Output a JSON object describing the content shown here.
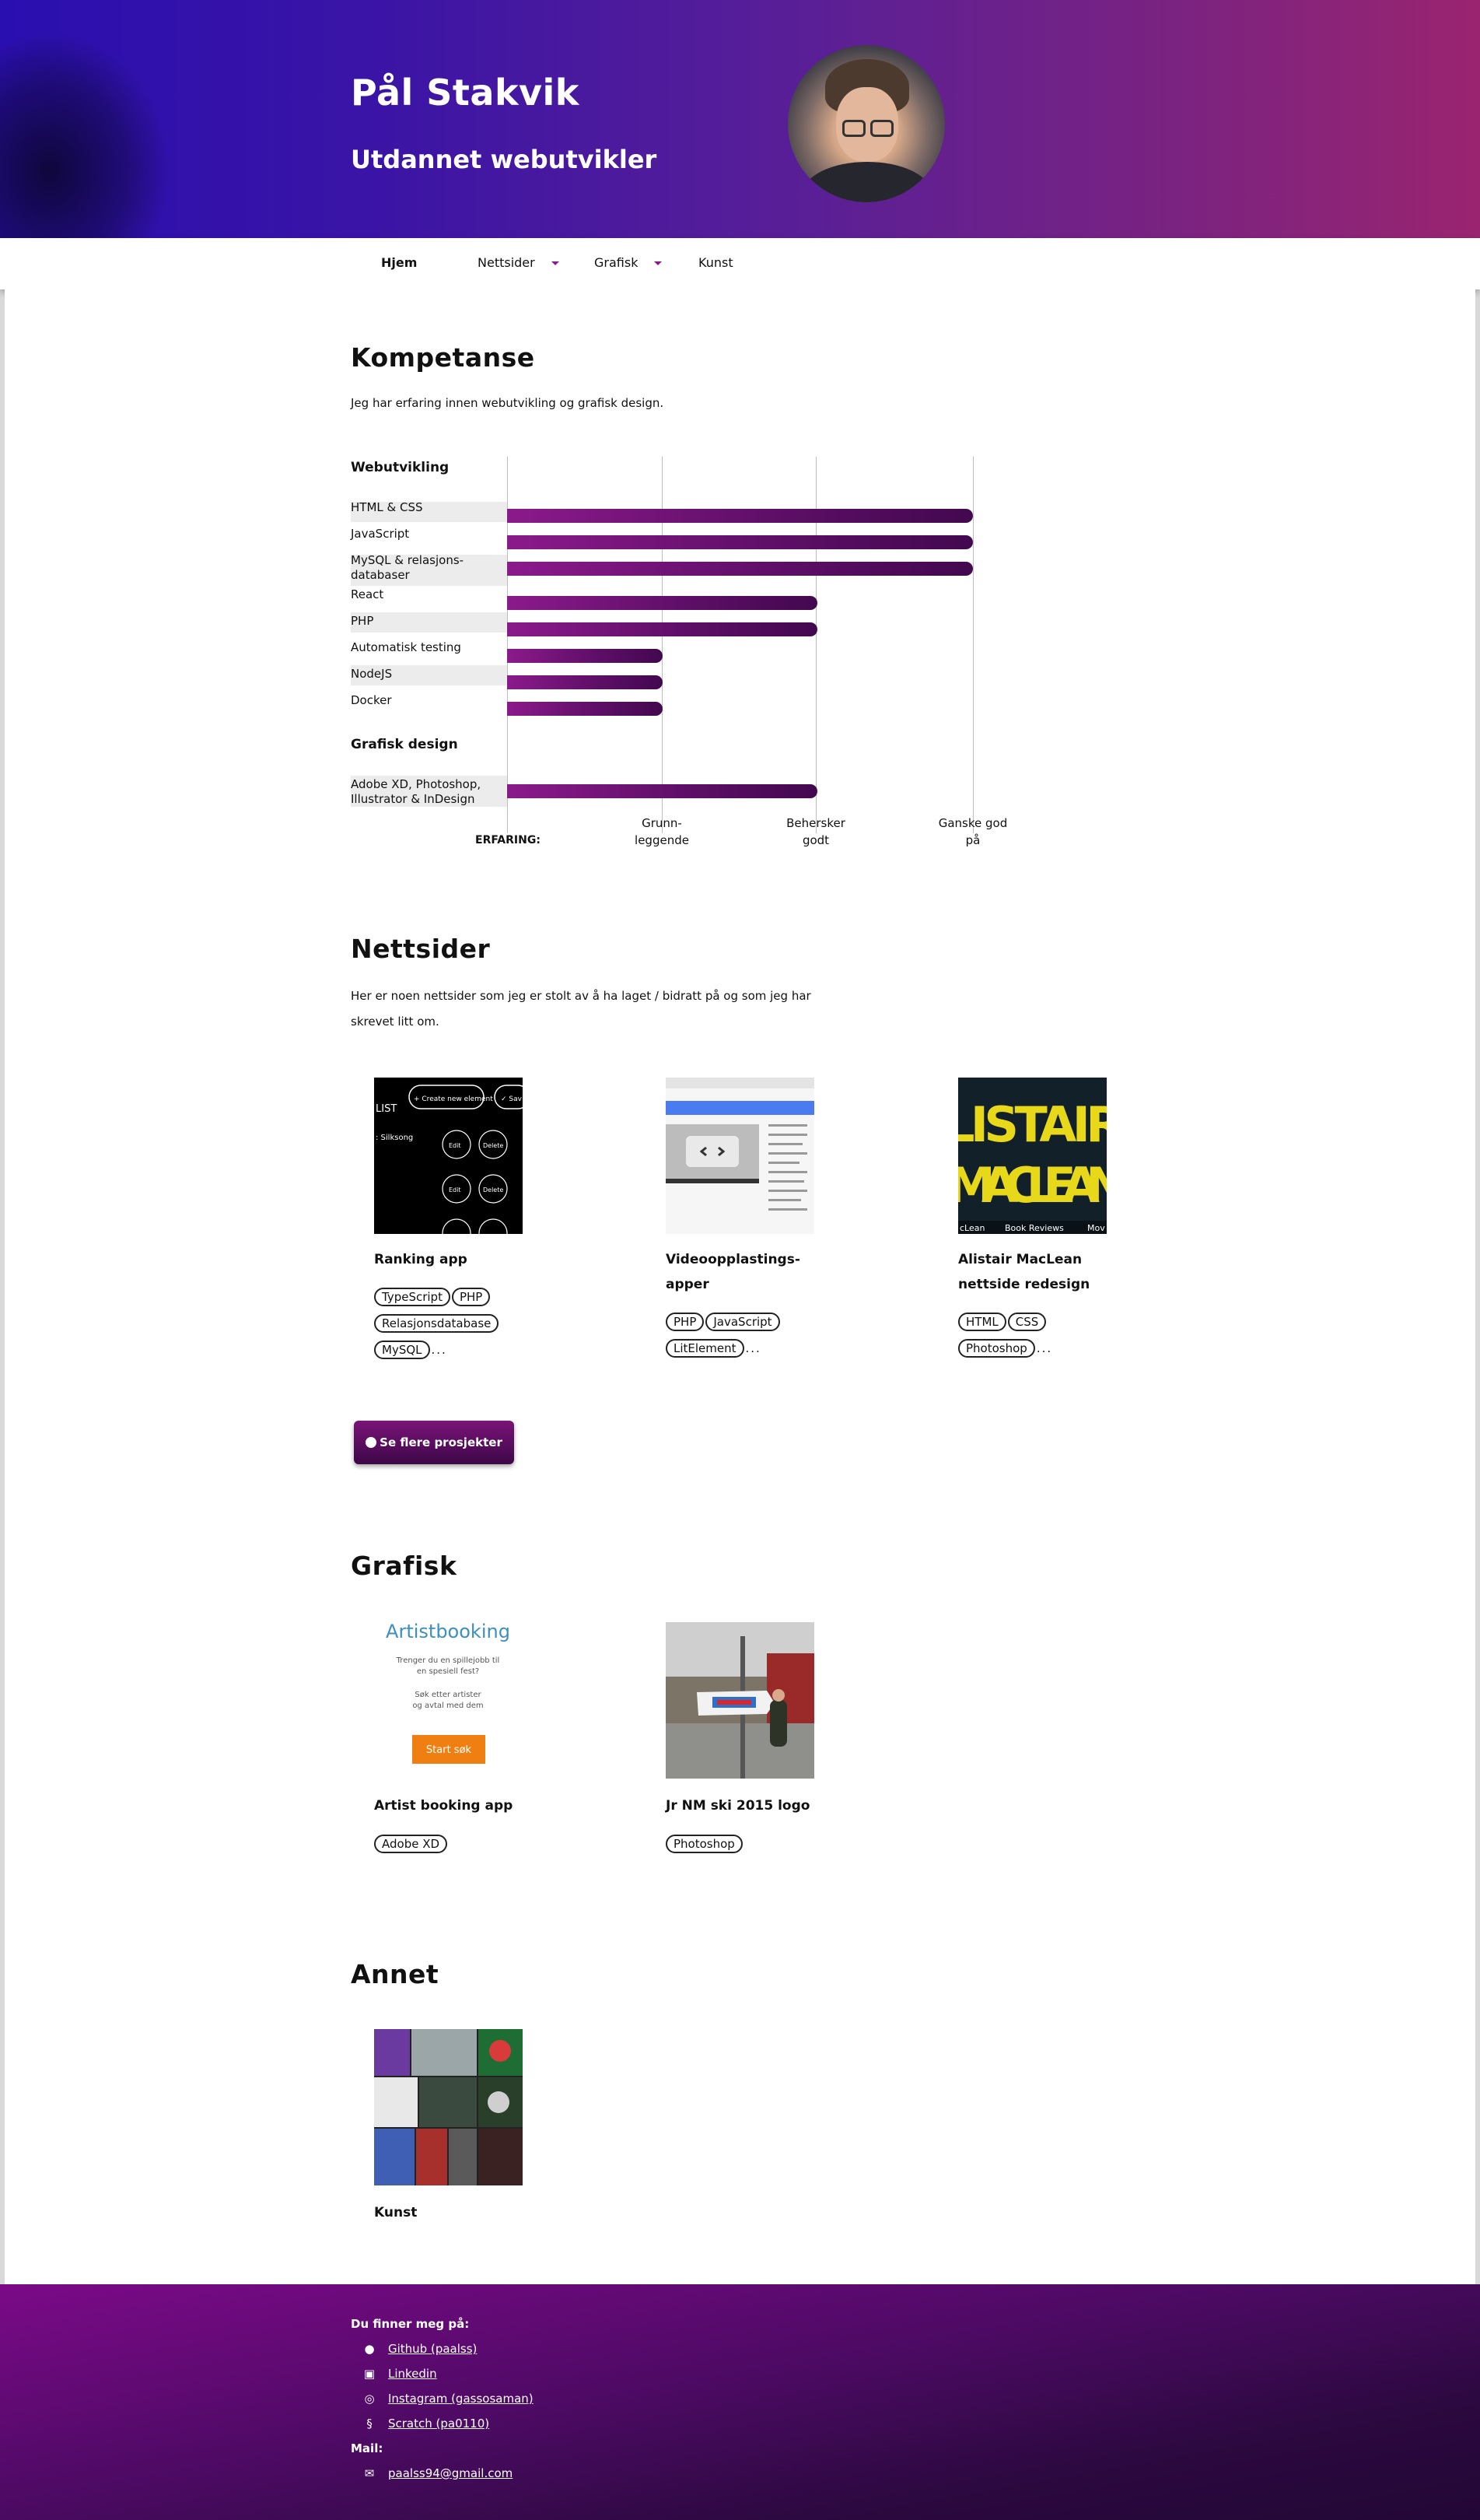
{
  "header": {
    "name": "Pål Stakvik",
    "role": "Utdannet webutvikler",
    "gradient_colors": [
      "#2a0fb0",
      "#9a2470"
    ]
  },
  "nav": {
    "items": [
      {
        "label": "Hjem",
        "active": true,
        "dropdown": false
      },
      {
        "label": "Nettsider",
        "active": false,
        "dropdown": true
      },
      {
        "label": "Grafisk",
        "active": false,
        "dropdown": true
      },
      {
        "label": "Kunst",
        "active": false,
        "dropdown": false
      }
    ]
  },
  "kompetanse": {
    "title": "Kompetanse",
    "intro": "Jeg har erfaring innen webutvikling og grafisk design.",
    "axis_title": "ERFARING:",
    "axis_levels": [
      "Grunn-leggende",
      "Behersker godt",
      "Ganske god på"
    ],
    "axis_lines": [
      [
        "Grunn-",
        "leggende"
      ],
      [
        "Behersker",
        "godt"
      ],
      [
        "Ganske god",
        "på"
      ]
    ]
  },
  "chart_data": {
    "type": "bar",
    "orientation": "horizontal",
    "title": "",
    "xlabel": "ERFARING:",
    "x_categories": [
      "Grunn-leggende",
      "Behersker godt",
      "Ganske god på"
    ],
    "xlim": [
      0,
      3
    ],
    "groups": [
      {
        "name": "Webutvikling",
        "categories": [
          "HTML & CSS",
          "JavaScript",
          "MySQL & relasjons-databaser",
          "React",
          "PHP",
          "Automatisk testing",
          "NodeJS",
          "Docker"
        ],
        "values": [
          3,
          3,
          3,
          2,
          2,
          1,
          1,
          1
        ]
      },
      {
        "name": "Grafisk design",
        "categories": [
          "Adobe XD, Photoshop, Illustrator & InDesign"
        ],
        "values": [
          2
        ]
      }
    ],
    "bar_color": "#6a0f73",
    "grid": true
  },
  "skill_labels": {
    "html": "HTML & CSS",
    "js": "JavaScript",
    "mysql": [
      "MySQL & relasjons-",
      "databaser"
    ],
    "react": "React",
    "php": "PHP",
    "testing": "Automatisk testing",
    "node": "NodeJS",
    "docker": "Docker",
    "adobe": [
      "Adobe XD, Photoshop,",
      "Illustrator & InDesign"
    ]
  },
  "nettsider": {
    "title": "Nettsider",
    "intro_lines": [
      "Her er noen nettsider som jeg er stolt av å ha laget / bidratt på og som jeg har",
      "skrevet litt om."
    ],
    "projects": [
      {
        "title_lines": [
          "Ranking app"
        ],
        "tags": [
          "TypeScript",
          "PHP",
          "Relasjonsdatabase",
          "MySQL"
        ],
        "more": "...",
        "thumb_text": {
          "list": "LIST",
          "create": "+ Create new element",
          "save": "✓ Sav",
          "sub": ": Silksong",
          "edit": "Edit",
          "delete": "Delete"
        }
      },
      {
        "title_lines": [
          "Videoopplastings-",
          "apper"
        ],
        "tags": [
          "PHP",
          "JavaScript",
          "LitElement"
        ],
        "more": "..."
      },
      {
        "title_lines": [
          "Alistair MacLean",
          "nettside redesign"
        ],
        "tags": [
          "HTML",
          "CSS",
          "Photoshop"
        ],
        "more": "...",
        "thumb_text": {
          "line1": "LISTAIR",
          "line2": "MACLEAN",
          "menu": [
            "cLean",
            "Book Reviews",
            "Mov"
          ]
        }
      }
    ],
    "button_label": "Se flere prosjekter"
  },
  "grafisk": {
    "title": "Grafisk",
    "projects": [
      {
        "title": "Artist booking app",
        "tags": [
          "Adobe XD"
        ],
        "thumb_text": {
          "brand": "Artistbooking",
          "q1": "Trenger du en spillejobb til",
          "q2": "en spesiell fest?",
          "s1": "Søk etter artister",
          "s2": "og avtal med dem",
          "cta": "Start søk"
        }
      },
      {
        "title": "Jr NM ski 2015 logo",
        "tags": [
          "Photoshop"
        ]
      }
    ]
  },
  "annet": {
    "title": "Annet",
    "projects": [
      {
        "title": "Kunst"
      }
    ]
  },
  "footer": {
    "find_me": "Du finner meg på:",
    "links": [
      {
        "icon": "github-icon",
        "label": "Github (paalss)"
      },
      {
        "icon": "linkedin-icon",
        "label": "Linkedin"
      },
      {
        "icon": "instagram-icon",
        "label": "Instagram (gassosaman)"
      },
      {
        "icon": "scratch-icon",
        "label": "Scratch (pa0110)"
      }
    ],
    "mail_head": "Mail:",
    "mail": {
      "icon": "envelope-icon",
      "label": "paalss94@gmail.com"
    }
  }
}
